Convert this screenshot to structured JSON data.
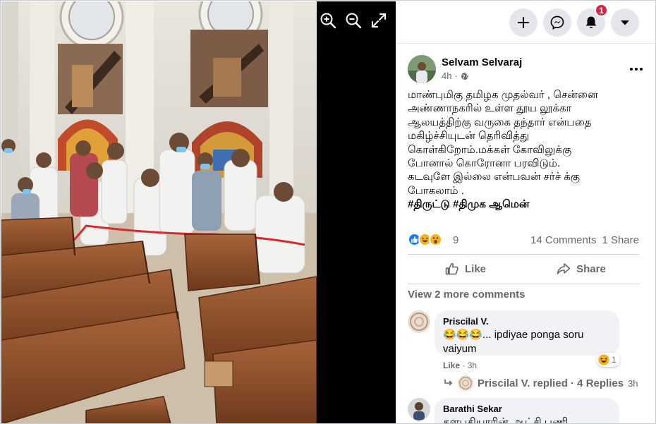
{
  "viewer": {
    "tools": [
      {
        "icon": "zoom-in-icon"
      },
      {
        "icon": "zoom-out-icon"
      },
      {
        "icon": "fullscreen-icon"
      }
    ]
  },
  "topbar": {
    "create_icon": "plus-icon",
    "messenger_icon": "messenger-icon",
    "notifications_icon": "bell-icon",
    "notification_count": "1",
    "account_icon": "caret-down-icon"
  },
  "post": {
    "author": "Selvam Selvaraj",
    "time": "4h",
    "audience_icon": "globe-icon",
    "lines": [
      "மாண்புமிகு தமிழக முதல்வர் , சென்னை",
      "அண்ணாநகரில் உள்ள தூய லூக்கா",
      "ஆலயத்திற்கு வருகை தந்தார் என்பதை",
      "மகிழ்ச்சியுடன் தெரிவித்து",
      "கொள்கிறோம்.மக்கள் கோவிலுக்கு",
      "போனால் கொரோனா பரவிடும்.",
      "கடவுளே இல்லை என்பவன் சர்ச் க்கு",
      "போகலாம் ."
    ],
    "hashtags": [
      "#திருட்டு",
      "#திமுக",
      "ஆமென்"
    ],
    "reaction_count": "9",
    "comments": "14 Comments",
    "shares": "1 Share",
    "like_label": "Like",
    "share_label": "Share"
  },
  "view_more": "View 2 more comments",
  "comments": [
    {
      "name": "Priscilal V.",
      "text_line1": "😂😂😂... ipdiyae ponga soru",
      "text_line2": "vaiyum",
      "like": "Like",
      "time": "3h",
      "reaction_count": "1"
    },
    {
      "name": "Barathi Sekar",
      "text_line1": "தளபதியாரின் ஆட்சி பணி"
    }
  ],
  "replies": {
    "label": "Priscilal V. replied · 4 Replies",
    "time": "3h"
  },
  "colors": {
    "accent": "#1877f2",
    "secondary_text": "#65676b",
    "badge": "#e41e3f"
  }
}
